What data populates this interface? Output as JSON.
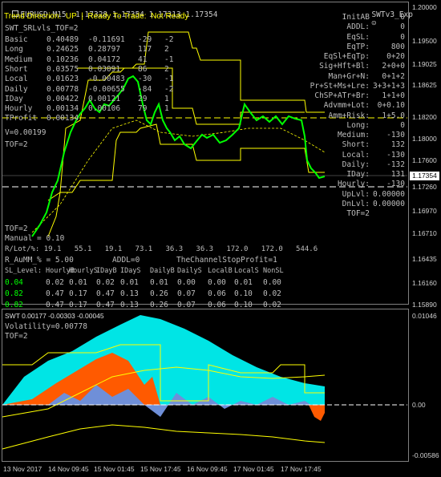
{
  "header": {
    "symbol": "EURUSD,M15",
    "ohlc": "1.17328 1.17354 1.17313 1.17354",
    "ea_name": "SWTv3_Exp",
    "trend_label": "Trend Direcrion:",
    "trend_value": "UP",
    "separator": "|",
    "ready_label": "Ready To Trade:",
    "ready_value": "Not Ready"
  },
  "left_panel": {
    "title": "SWT_SRLvls_TOF=2",
    "rows": [
      {
        "name": "Basic",
        "v1": "0.40489",
        "v2": "-0.11691",
        "v3": "-29",
        "v4": "-2"
      },
      {
        "name": "Long",
        "v1": "0.24625",
        "v2": "0.28797",
        "v3": "117",
        "v4": "2"
      },
      {
        "name": "Medium",
        "v1": "0.10236",
        "v2": "0.04172",
        "v3": "41",
        "v4": "-1"
      },
      {
        "name": "Short",
        "v1": "0.03575",
        "v2": "0.03091",
        "v3": "86",
        "v4": "2"
      },
      {
        "name": "Local",
        "v1": "0.01623",
        "v2": "-0.00483",
        "v3": "-30",
        "v4": "-1"
      },
      {
        "name": "Daily",
        "v1": "0.00778",
        "v2": "-0.00655",
        "v3": "-84",
        "v4": "-2"
      },
      {
        "name": "IDay",
        "v1": "0.00422",
        "v2": "0.00121",
        "v3": "29",
        "v4": "1"
      },
      {
        "name": "Hourly",
        "v1": "0.00134",
        "v2": "0.00106",
        "v3": "79",
        "v4": "1"
      },
      {
        "name": "TProfit",
        "v1": "0.00134",
        "v2": "",
        "v3": "",
        "v4": ""
      }
    ],
    "v_line": "V=0.00199",
    "tof_line": "TOF=2",
    "tof_line2": "TOF=2",
    "manual_line": "Manual = 0.10",
    "lots_line": "R/Lot/%: 19.1   55.1   19.1   73.1   36.3   36.3   172.0   172.0   544.6",
    "aumm_line": "R_AuMM_% = 5.00",
    "addl_line": "ADDL=0",
    "stop_line": "TheChannelStopProfit=1",
    "sl_header": [
      "SL_Level:",
      "HourlyB",
      "HourlyS",
      "IDayB",
      "IDayS",
      "DailyB",
      "DailyS",
      "LocalB",
      "LocalS",
      "NonSL"
    ],
    "sl_rows": [
      [
        "0.04",
        "0.02",
        "0.01",
        "0.02",
        "0.01",
        "0.01",
        "0.00",
        "0.00",
        "0.01",
        "0.00"
      ],
      [
        "0.82",
        "0.47",
        "0.17",
        "0.47",
        "0.13",
        "0.26",
        "0.07",
        "0.06",
        "0.10",
        "0.02"
      ],
      [
        "0.82",
        "0.47",
        "0.17",
        "0.47",
        "0.13",
        "0.26",
        "0.07",
        "0.06",
        "0.10",
        "0.02"
      ]
    ]
  },
  "right_panel": {
    "rows": [
      {
        "label": "InitAB",
        "value": "0"
      },
      {
        "label": "ADDL:",
        "value": "0"
      },
      {
        "label": "EqSL:",
        "value": "0"
      },
      {
        "label": "EqTP:",
        "value": "800"
      },
      {
        "label": "EqSl+EqTp:",
        "value": "0+20"
      },
      {
        "label": "Sig+Hft+Bl:",
        "value": "2+0+0"
      },
      {
        "label": "Man+Gr+N:",
        "value": "0+1+2"
      },
      {
        "label": "Pr+St+Ms+Lre:",
        "value": "3+3+1+3"
      },
      {
        "label": "ChSP+ATr+Br:",
        "value": "1+1+0"
      },
      {
        "label": "Advmm+Lot:",
        "value": "0+0.10"
      },
      {
        "label": "Amm+Risk:",
        "value": "1+5.0"
      },
      {
        "label": "Long:",
        "value": "0"
      },
      {
        "label": "Medium:",
        "value": "-130"
      },
      {
        "label": "Short:",
        "value": "132"
      },
      {
        "label": "Local:",
        "value": "-130"
      },
      {
        "label": "Daily:",
        "value": "-132"
      },
      {
        "label": "IDay:",
        "value": "131"
      },
      {
        "label": "Hourly:",
        "value": "-130"
      },
      {
        "label": "UpLvl:",
        "value": "0.00000"
      },
      {
        "label": "DnLvl:",
        "value": "0.00000"
      },
      {
        "label": "TOF=2",
        "value": ""
      }
    ]
  },
  "price_axis": [
    "1.20000",
    "1.19500",
    "1.19025",
    "1.18625",
    "1.18200",
    "1.18000",
    "1.17600",
    "1.17354",
    "1.17260",
    "1.16970",
    "1.16710",
    "1.16435",
    "1.16160",
    "1.15890"
  ],
  "price_badge": "1.17354",
  "lower_panel": {
    "title": "SWT 0.00177 -0.00303 -0.00045",
    "volatility": "Volatility=0.00778",
    "tof": "TOF=2",
    "axis_top": "0.01046",
    "axis_zero": "0.00",
    "axis_bottom": "-0.00586"
  },
  "time_axis": [
    "13 Nov 2017",
    "14 Nov 09:45",
    "15 Nov 01:45",
    "15 Nov 17:45",
    "16 Nov 09:45",
    "17 Nov 01:45",
    "17 Nov 17:45"
  ],
  "colors": {
    "background": "#000000",
    "up_candle": "#00ff00",
    "levels": "#ffff00",
    "swt_cyan": "#00e5e5",
    "swt_orange": "#ff5a00",
    "swt_blue": "#6f8fd8"
  }
}
